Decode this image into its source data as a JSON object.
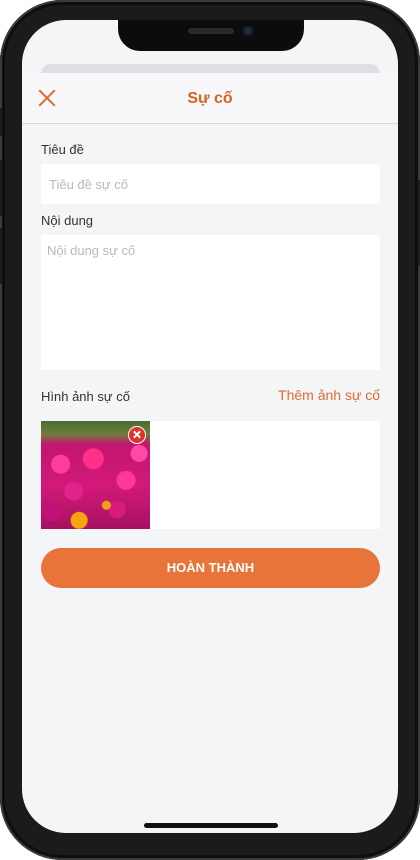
{
  "header": {
    "title": "Sự cố",
    "close_icon": "close-icon"
  },
  "form": {
    "title_label": "Tiêu đề",
    "title_placeholder": "Tiêu đề sự cố",
    "title_value": "",
    "content_label": "Nội dung",
    "content_placeholder": "Nội dung sự cố",
    "content_value": "",
    "images_label": "Hình ảnh sự cố",
    "add_image_label": "Thêm ảnh sự cố",
    "submit_label": "HOÀN THÀNH"
  },
  "colors": {
    "accent": "#e06b2e",
    "button": "#e8743a",
    "background": "#f4f5f7",
    "remove": "#e0312d"
  }
}
